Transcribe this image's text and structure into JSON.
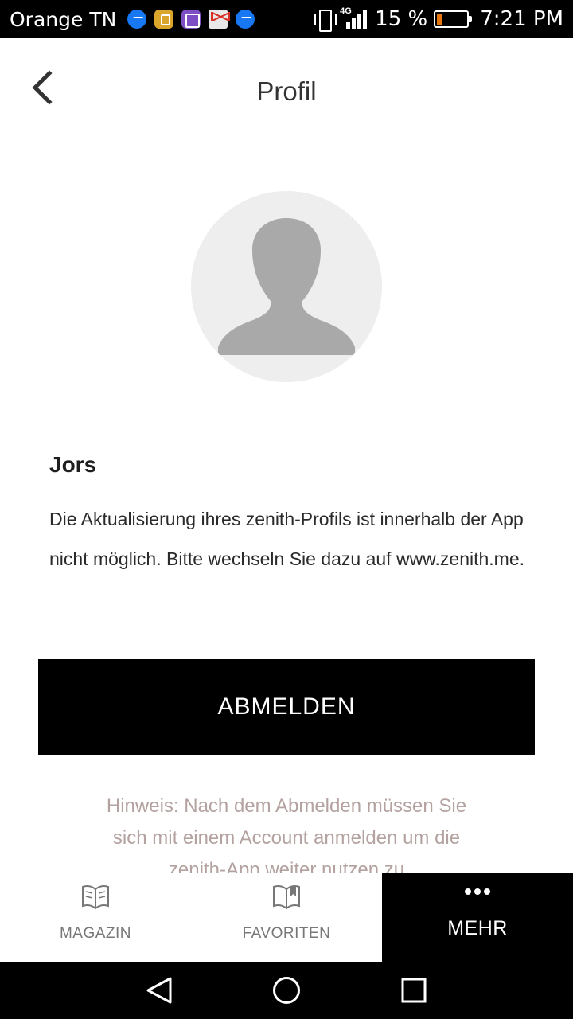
{
  "status_bar": {
    "carrier": "Orange TN",
    "notifications": [
      "messenger-icon",
      "app-icon",
      "gallery-icon",
      "gmail-icon",
      "messenger-icon"
    ],
    "network": "4G",
    "battery_percent": "15 %",
    "time": "7:21 PM"
  },
  "header": {
    "title": "Profil"
  },
  "profile": {
    "name": "Jors",
    "note": "Die Aktualisierung ihres zenith-Profils ist innerhalb der App nicht möglich. Bitte wechseln Sie dazu auf www.zenith.me."
  },
  "logout": {
    "label": "ABMELDEN"
  },
  "hint": {
    "text": "Hinweis: Nach dem Abmelden müssen Sie sich mit einem Account anmelden um die zenith-App weiter nutzen zu"
  },
  "tabs": [
    {
      "label": "MAGAZIN",
      "icon": "open-book-icon",
      "active": false
    },
    {
      "label": "FAVORITEN",
      "icon": "bookmarked-book-icon",
      "active": false
    },
    {
      "label": "MEHR",
      "icon": "more-dots-icon",
      "active": true
    }
  ],
  "colors": {
    "accent": "#000000",
    "hint_text": "#b3a2a0",
    "avatar_bg": "#eeeeee",
    "avatar_silhouette": "#a9a9a9"
  }
}
